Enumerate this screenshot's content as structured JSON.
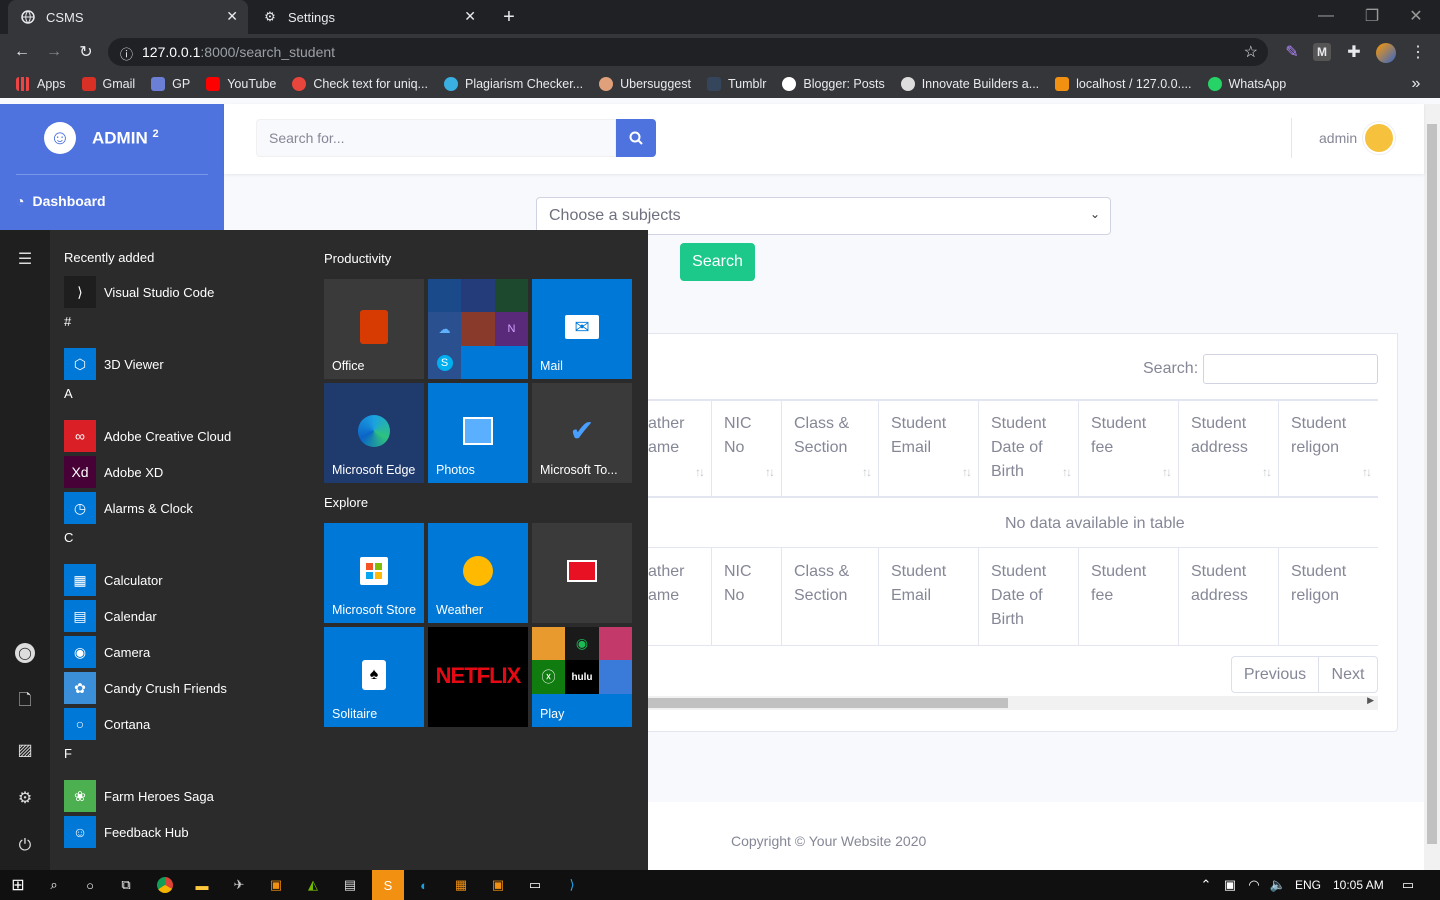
{
  "browser": {
    "tabs": [
      {
        "label": "CSMS",
        "icon": "globe-icon",
        "active": true
      },
      {
        "label": "Settings",
        "icon": "gear-icon",
        "active": false
      }
    ],
    "url_host": "127.0.0.1",
    "url_rest": ":8000/search_student",
    "bookmarks": [
      {
        "label": "Apps",
        "color": "#e44"
      },
      {
        "label": "Gmail",
        "color": "#d93025"
      },
      {
        "label": "GP",
        "color": "#6b7fd7"
      },
      {
        "label": "YouTube",
        "color": "#ff0000"
      },
      {
        "label": "Check text for uniq...",
        "color": "#e8453c"
      },
      {
        "label": "Plagiarism Checker...",
        "color": "#3ab0e2"
      },
      {
        "label": "Ubersuggest",
        "color": "#e0a07a"
      },
      {
        "label": "Tumblr",
        "color": "#35465c"
      },
      {
        "label": "Blogger: Posts",
        "color": "#ffffff"
      },
      {
        "label": "Innovate Builders a...",
        "color": "#dddddd"
      },
      {
        "label": "localhost / 127.0.0....",
        "color": "#f29111"
      },
      {
        "label": "WhatsApp",
        "color": "#25d366"
      }
    ]
  },
  "sidebar": {
    "brand": "ADMIN",
    "brand_sup": "2",
    "dashboard": "Dashboard"
  },
  "topbar": {
    "search_placeholder": "Search for...",
    "user": "admin"
  },
  "form": {
    "select_value": "Choose a subjects",
    "search_button": "Search"
  },
  "table": {
    "search_label": "Search:",
    "headers": [
      {
        "l1": "ather",
        "l2": "ame"
      },
      {
        "l1": "NIC",
        "l2": "No"
      },
      {
        "l1": "Class &",
        "l2": "Section"
      },
      {
        "l1": "Student",
        "l2": "Email"
      },
      {
        "l1": "Student",
        "l2": "Date of",
        "l3": "Birth"
      },
      {
        "l1": "Student",
        "l2": "fee"
      },
      {
        "l1": "Student",
        "l2": "address"
      },
      {
        "l1": "Student",
        "l2": "religon"
      }
    ],
    "empty": "No data available in table",
    "prev": "Previous",
    "next": "Next"
  },
  "footer": "Copyright © Your Website 2020",
  "start_menu": {
    "recently_added": "Recently added",
    "apps": [
      {
        "label": "Visual Studio Code",
        "color": "#1e1e1e",
        "glyph": "⟩"
      },
      {
        "letter": "#"
      },
      {
        "label": "3D Viewer",
        "color": "#0078d7",
        "glyph": "⬡"
      },
      {
        "letter": "A"
      },
      {
        "label": "Adobe Creative Cloud",
        "color": "#da1f26",
        "glyph": "∞"
      },
      {
        "label": "Adobe XD",
        "color": "#470137",
        "glyph": "Xd"
      },
      {
        "label": "Alarms & Clock",
        "color": "#0078d7",
        "glyph": "◷"
      },
      {
        "letter": "C"
      },
      {
        "label": "Calculator",
        "color": "#0078d7",
        "glyph": "▦"
      },
      {
        "label": "Calendar",
        "color": "#0078d7",
        "glyph": "▤"
      },
      {
        "label": "Camera",
        "color": "#0078d7",
        "glyph": "◉"
      },
      {
        "label": "Candy Crush Friends",
        "color": "#3a8fd8",
        "glyph": "✿"
      },
      {
        "label": "Cortana",
        "color": "#0078d7",
        "glyph": "○"
      },
      {
        "letter": "F"
      },
      {
        "label": "Farm Heroes Saga",
        "color": "#4caf50",
        "glyph": "❀"
      },
      {
        "label": "Feedback Hub",
        "color": "#0078d7",
        "glyph": "☺"
      }
    ],
    "productivity": "Productivity",
    "explore": "Explore",
    "tiles": [
      {
        "label": "Office",
        "color": "#3a3a3a"
      },
      {
        "label": "",
        "color": "#1f4e8a"
      },
      {
        "label": "Mail",
        "color": "#0078d7"
      },
      {
        "label": "Microsoft Edge",
        "color": "#1f3b6e"
      },
      {
        "label": "Photos",
        "color": "#0078d7"
      },
      {
        "label": "Microsoft To...",
        "color": "#3a3a3a"
      },
      {
        "label": "Microsoft Store",
        "color": "#0078d7"
      },
      {
        "label": "Weather",
        "color": "#0078d7"
      },
      {
        "label": "",
        "color": "#3a3a3a"
      },
      {
        "label": "Solitaire",
        "color": "#0078d7"
      },
      {
        "label": "NETFLIX",
        "color": "#000000"
      },
      {
        "label": "Play",
        "color": "#0078d7"
      }
    ]
  },
  "taskbar": {
    "lang": "ENG",
    "time": "10:05 AM"
  }
}
